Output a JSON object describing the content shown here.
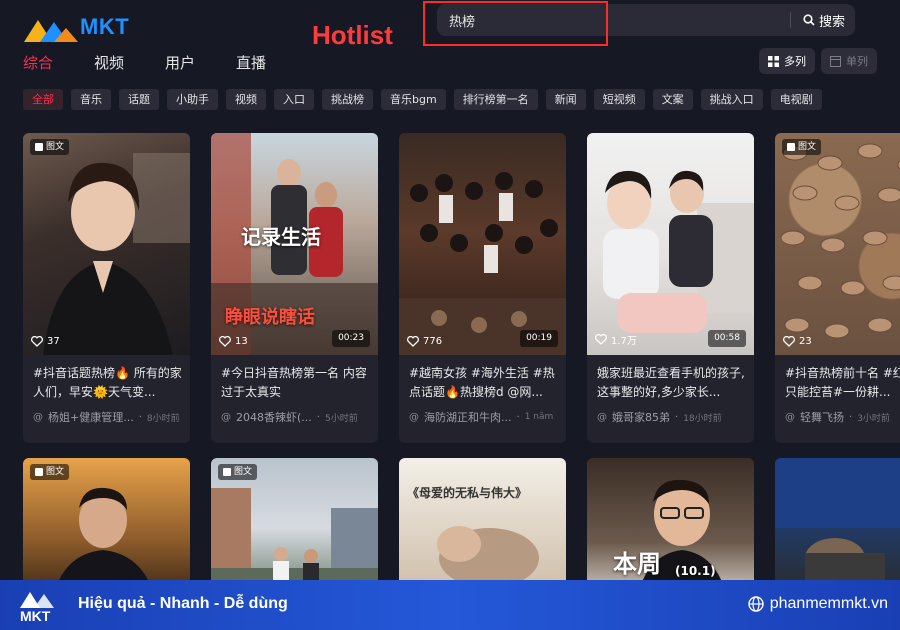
{
  "brand": {
    "logo_text": "MKT",
    "accent": "#fe2c55"
  },
  "annotation": {
    "label": "Hotlist",
    "color": "#ff3b3b"
  },
  "search": {
    "value": "热榜",
    "button_label": "搜索"
  },
  "tabs": [
    {
      "label": "综合",
      "active": true
    },
    {
      "label": "视频",
      "active": false
    },
    {
      "label": "用户",
      "active": false
    },
    {
      "label": "直播",
      "active": false
    }
  ],
  "view": {
    "multi_label": "多列",
    "single_label": "单列"
  },
  "filters": [
    "全部",
    "音乐",
    "话题",
    "小助手",
    "视频",
    "入口",
    "挑战榜",
    "音乐bgm",
    "排行榜第一名",
    "新闻",
    "短视频",
    "文案",
    "挑战入口",
    "电视剧"
  ],
  "cards": [
    {
      "badge": "图文",
      "likes": "37",
      "duration": "",
      "desc": "#抖音话题热榜🔥 所有的家人们，早安🌞天气变...",
      "author": "杨姐+健康管理...",
      "time": "8小时前"
    },
    {
      "badge": "",
      "likes": "13",
      "duration": "00:23",
      "desc": "#今日抖音热榜第一名 内容过于太真实",
      "author": "2048香辣虾(...",
      "time": "5小时前",
      "overlay": [
        "记录生活",
        "睁眼说瞎话"
      ]
    },
    {
      "badge": "",
      "likes": "776",
      "duration": "00:19",
      "desc": "#越南女孩 #海外生活 #热点话题🔥热搜榜d @网...",
      "author": "海防湖正和牛肉...",
      "time": "1 năm"
    },
    {
      "badge": "",
      "likes": "1.7万",
      "duration": "00:58",
      "desc": "娥家班最近查看手机的孩子,这事整的好,多少家长...",
      "author": "娥哥家85弟",
      "time": "18小时前"
    },
    {
      "badge": "图文",
      "likes": "23",
      "duration": "",
      "desc": "#抖音热榜前十名 #红出息只能控苔#一份耕...",
      "author": "轻舞飞扬",
      "time": "3小时前"
    }
  ],
  "cards_row2": [
    {
      "badge": "图文"
    },
    {
      "badge": "图文"
    },
    {
      "badge": "",
      "overlay": "《母爱的无私与伟大》"
    },
    {
      "badge": "",
      "overlay": "本周",
      "overlay_sub": "(10.1)"
    },
    {
      "badge": ""
    }
  ],
  "footer": {
    "logo_text": "MKT",
    "slogan": "Hiệu quả - Nhanh  - Dễ dùng",
    "site": "phanmemmkt.vn"
  }
}
